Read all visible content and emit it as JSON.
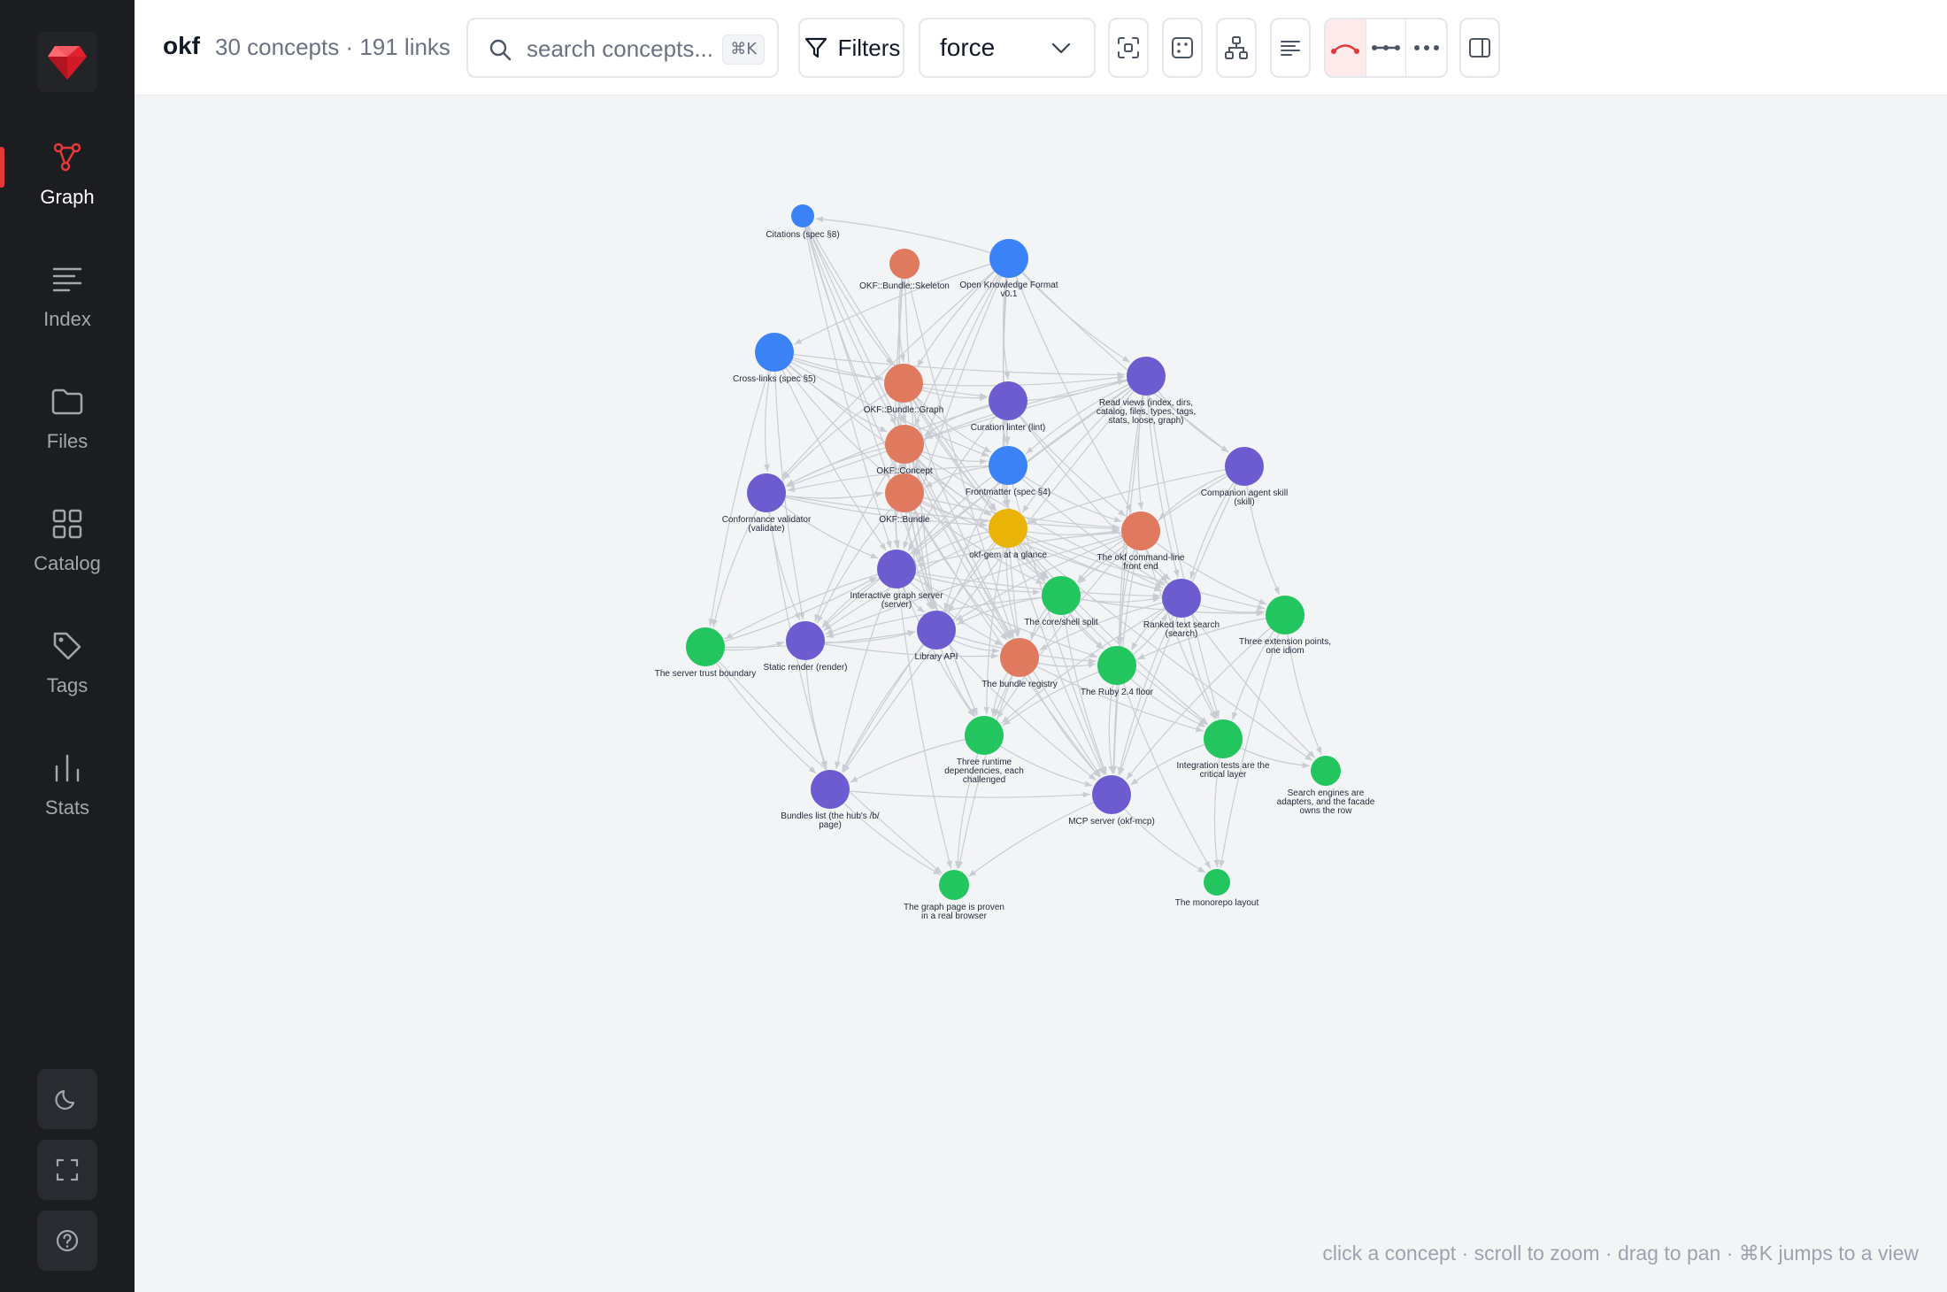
{
  "sidebar": {
    "items": [
      {
        "label": "Graph",
        "icon": "graph-icon",
        "active": true
      },
      {
        "label": "Index",
        "icon": "list-icon"
      },
      {
        "label": "Files",
        "icon": "folder-icon"
      },
      {
        "label": "Catalog",
        "icon": "grid-icon"
      },
      {
        "label": "Tags",
        "icon": "tag-icon"
      },
      {
        "label": "Stats",
        "icon": "bar-chart-icon"
      }
    ],
    "bottom": [
      "moon-icon",
      "fullscreen-icon",
      "help-icon"
    ]
  },
  "topbar": {
    "brand": "okf",
    "counts": "30 concepts · 191 links",
    "search_placeholder": "search concepts...",
    "search_shortcut": "⌘K",
    "filters_label": "Filters",
    "layout_value": "force"
  },
  "colors": {
    "accent": "#e5383b",
    "blue": "#3b82f6",
    "orange": "#e07a5f",
    "purple": "#6d5bd0",
    "green": "#22c55e",
    "yellow": "#eab308",
    "edge": "#c9ccd3"
  },
  "graph": {
    "nodes": [
      {
        "id": 0,
        "label": [
          "Citations (spec §8)"
        ],
        "color": "blue",
        "r": 13
      },
      {
        "id": 1,
        "label": [
          "OKF::Bundle::Skeleton"
        ],
        "color": "orange",
        "r": 17
      },
      {
        "id": 2,
        "label": [
          "Open Knowledge Format",
          "v0.1"
        ],
        "color": "blue",
        "r": 22
      },
      {
        "id": 3,
        "label": [
          "Cross-links (spec §5)"
        ],
        "color": "blue",
        "r": 22
      },
      {
        "id": 4,
        "label": [
          "OKF::Bundle::Graph"
        ],
        "color": "orange",
        "r": 22
      },
      {
        "id": 5,
        "label": [
          "Curation linter (lint)"
        ],
        "color": "purple",
        "r": 22
      },
      {
        "id": 6,
        "label": [
          "Read views (index, dirs,",
          "catalog, files, types, tags,",
          "stats, loose, graph)"
        ],
        "color": "purple",
        "r": 22
      },
      {
        "id": 7,
        "label": [
          "OKF::Concept"
        ],
        "color": "orange",
        "r": 22
      },
      {
        "id": 8,
        "label": [
          "Frontmatter (spec §4)"
        ],
        "color": "blue",
        "r": 22
      },
      {
        "id": 9,
        "label": [
          "Companion agent skill",
          "(skill)"
        ],
        "color": "purple",
        "r": 22
      },
      {
        "id": 10,
        "label": [
          "Conformance validator",
          "(validate)"
        ],
        "color": "purple",
        "r": 22
      },
      {
        "id": 11,
        "label": [
          "OKF::Bundle"
        ],
        "color": "orange",
        "r": 22
      },
      {
        "id": 12,
        "label": [
          "okf-gem at a glance"
        ],
        "color": "yellow",
        "r": 22
      },
      {
        "id": 13,
        "label": [
          "The okf command-line",
          "front end"
        ],
        "color": "orange",
        "r": 22
      },
      {
        "id": 14,
        "label": [
          "Interactive graph server",
          "(server)"
        ],
        "color": "purple",
        "r": 22
      },
      {
        "id": 15,
        "label": [
          "The core/shell split"
        ],
        "color": "green",
        "r": 22
      },
      {
        "id": 16,
        "label": [
          "Ranked text search",
          "(search)"
        ],
        "color": "purple",
        "r": 22
      },
      {
        "id": 17,
        "label": [
          "Three extension points,",
          "one idiom"
        ],
        "color": "green",
        "r": 22
      },
      {
        "id": 18,
        "label": [
          "The server trust boundary"
        ],
        "color": "green",
        "r": 22
      },
      {
        "id": 19,
        "label": [
          "Static render (render)"
        ],
        "color": "purple",
        "r": 22
      },
      {
        "id": 20,
        "label": [
          "Library API"
        ],
        "color": "purple",
        "r": 22
      },
      {
        "id": 21,
        "label": [
          "The bundle registry"
        ],
        "color": "orange",
        "r": 22
      },
      {
        "id": 22,
        "label": [
          "The Ruby 2.4 floor"
        ],
        "color": "green",
        "r": 22
      },
      {
        "id": 23,
        "label": [
          "Three runtime",
          "dependencies, each",
          "challenged"
        ],
        "color": "green",
        "r": 22
      },
      {
        "id": 24,
        "label": [
          "Integration tests are the",
          "critical layer"
        ],
        "color": "green",
        "r": 22
      },
      {
        "id": 25,
        "label": [
          "Search engines are",
          "adapters, and the facade",
          "owns the row"
        ],
        "color": "green",
        "r": 17
      },
      {
        "id": 26,
        "label": [
          "Bundles list (the hub's /b/",
          "page)"
        ],
        "color": "purple",
        "r": 22
      },
      {
        "id": 27,
        "label": [
          "MCP server (okf-mcp)"
        ],
        "color": "purple",
        "r": 22
      },
      {
        "id": 28,
        "label": [
          "The graph page is proven",
          "in a real browser"
        ],
        "color": "green",
        "r": 17
      },
      {
        "id": 29,
        "label": [
          "The monorepo layout"
        ],
        "color": "green",
        "r": 15
      }
    ],
    "links": [
      [
        0,
        4
      ],
      [
        0,
        7
      ],
      [
        0,
        11
      ],
      [
        0,
        12
      ],
      [
        0,
        14
      ],
      [
        0,
        21
      ],
      [
        0,
        23
      ],
      [
        1,
        4
      ],
      [
        1,
        7
      ],
      [
        1,
        11
      ],
      [
        1,
        14
      ],
      [
        1,
        21
      ],
      [
        1,
        20
      ],
      [
        2,
        3
      ],
      [
        2,
        4
      ],
      [
        2,
        5
      ],
      [
        2,
        6
      ],
      [
        2,
        7
      ],
      [
        2,
        8
      ],
      [
        2,
        10
      ],
      [
        2,
        11
      ],
      [
        2,
        12
      ],
      [
        2,
        13
      ],
      [
        2,
        14
      ],
      [
        2,
        0
      ],
      [
        2,
        9
      ],
      [
        3,
        4
      ],
      [
        3,
        5
      ],
      [
        3,
        6
      ],
      [
        3,
        7
      ],
      [
        3,
        8
      ],
      [
        3,
        10
      ],
      [
        3,
        11
      ],
      [
        3,
        12
      ],
      [
        3,
        14
      ],
      [
        3,
        18
      ],
      [
        3,
        19
      ],
      [
        4,
        5
      ],
      [
        4,
        6
      ],
      [
        4,
        7
      ],
      [
        4,
        8
      ],
      [
        4,
        10
      ],
      [
        4,
        11
      ],
      [
        4,
        12
      ],
      [
        4,
        14
      ],
      [
        4,
        20
      ],
      [
        4,
        21
      ],
      [
        4,
        15
      ],
      [
        5,
        6
      ],
      [
        5,
        7
      ],
      [
        5,
        8
      ],
      [
        5,
        10
      ],
      [
        5,
        12
      ],
      [
        5,
        13
      ],
      [
        5,
        14
      ],
      [
        5,
        16
      ],
      [
        5,
        21
      ],
      [
        6,
        7
      ],
      [
        6,
        8
      ],
      [
        6,
        9
      ],
      [
        6,
        10
      ],
      [
        6,
        12
      ],
      [
        6,
        13
      ],
      [
        6,
        14
      ],
      [
        6,
        16
      ],
      [
        6,
        19
      ],
      [
        6,
        24
      ],
      [
        6,
        27
      ],
      [
        6,
        26
      ],
      [
        6,
        22
      ],
      [
        7,
        8
      ],
      [
        7,
        10
      ],
      [
        7,
        11
      ],
      [
        7,
        12
      ],
      [
        7,
        14
      ],
      [
        7,
        16
      ],
      [
        7,
        19
      ],
      [
        7,
        20
      ],
      [
        7,
        21
      ],
      [
        7,
        27
      ],
      [
        7,
        15
      ],
      [
        8,
        10
      ],
      [
        8,
        11
      ],
      [
        8,
        12
      ],
      [
        8,
        13
      ],
      [
        8,
        14
      ],
      [
        8,
        16
      ],
      [
        8,
        20
      ],
      [
        8,
        27
      ],
      [
        9,
        12
      ],
      [
        9,
        13
      ],
      [
        9,
        16
      ],
      [
        9,
        17
      ],
      [
        9,
        27
      ],
      [
        9,
        15
      ],
      [
        10,
        11
      ],
      [
        10,
        12
      ],
      [
        10,
        13
      ],
      [
        10,
        14
      ],
      [
        10,
        18
      ],
      [
        10,
        26
      ],
      [
        10,
        19
      ],
      [
        11,
        12
      ],
      [
        11,
        13
      ],
      [
        11,
        14
      ],
      [
        11,
        15
      ],
      [
        11,
        16
      ],
      [
        11,
        19
      ],
      [
        11,
        20
      ],
      [
        11,
        21
      ],
      [
        11,
        23
      ],
      [
        11,
        27
      ],
      [
        12,
        13
      ],
      [
        12,
        14
      ],
      [
        12,
        15
      ],
      [
        12,
        16
      ],
      [
        12,
        17
      ],
      [
        12,
        19
      ],
      [
        12,
        20
      ],
      [
        12,
        21
      ],
      [
        12,
        22
      ],
      [
        12,
        23
      ],
      [
        12,
        24
      ],
      [
        12,
        27
      ],
      [
        12,
        26
      ],
      [
        12,
        25
      ],
      [
        13,
        14
      ],
      [
        13,
        15
      ],
      [
        13,
        16
      ],
      [
        13,
        17
      ],
      [
        13,
        19
      ],
      [
        13,
        20
      ],
      [
        13,
        22
      ],
      [
        13,
        24
      ],
      [
        13,
        27
      ],
      [
        13,
        23
      ],
      [
        14,
        15
      ],
      [
        14,
        16
      ],
      [
        14,
        18
      ],
      [
        14,
        19
      ],
      [
        14,
        20
      ],
      [
        14,
        21
      ],
      [
        14,
        22
      ],
      [
        14,
        23
      ],
      [
        14,
        26
      ],
      [
        14,
        28
      ],
      [
        15,
        16
      ],
      [
        15,
        17
      ],
      [
        15,
        19
      ],
      [
        15,
        20
      ],
      [
        15,
        21
      ],
      [
        15,
        22
      ],
      [
        15,
        23
      ],
      [
        15,
        24
      ],
      [
        15,
        27
      ],
      [
        16,
        17
      ],
      [
        16,
        21
      ],
      [
        16,
        22
      ],
      [
        16,
        24
      ],
      [
        16,
        25
      ],
      [
        16,
        27
      ],
      [
        16,
        23
      ],
      [
        17,
        22
      ],
      [
        17,
        24
      ],
      [
        17,
        25
      ],
      [
        17,
        27
      ],
      [
        17,
        29
      ],
      [
        18,
        19
      ],
      [
        18,
        20
      ],
      [
        18,
        26
      ],
      [
        18,
        28
      ],
      [
        18,
        14
      ],
      [
        19,
        20
      ],
      [
        19,
        21
      ],
      [
        19,
        26
      ],
      [
        20,
        21
      ],
      [
        20,
        22
      ],
      [
        20,
        23
      ],
      [
        20,
        27
      ],
      [
        20,
        26
      ],
      [
        21,
        22
      ],
      [
        21,
        23
      ],
      [
        21,
        24
      ],
      [
        21,
        27
      ],
      [
        21,
        28
      ],
      [
        22,
        23
      ],
      [
        22,
        24
      ],
      [
        22,
        27
      ],
      [
        22,
        29
      ],
      [
        22,
        16
      ],
      [
        23,
        28
      ],
      [
        23,
        27
      ],
      [
        23,
        26
      ],
      [
        24,
        29
      ],
      [
        24,
        25
      ],
      [
        24,
        27
      ],
      [
        26,
        27
      ],
      [
        26,
        28
      ],
      [
        27,
        28
      ],
      [
        27,
        29
      ]
    ]
  },
  "hint": "click a concept · scroll to zoom · drag to pan · ⌘K jumps to a view"
}
